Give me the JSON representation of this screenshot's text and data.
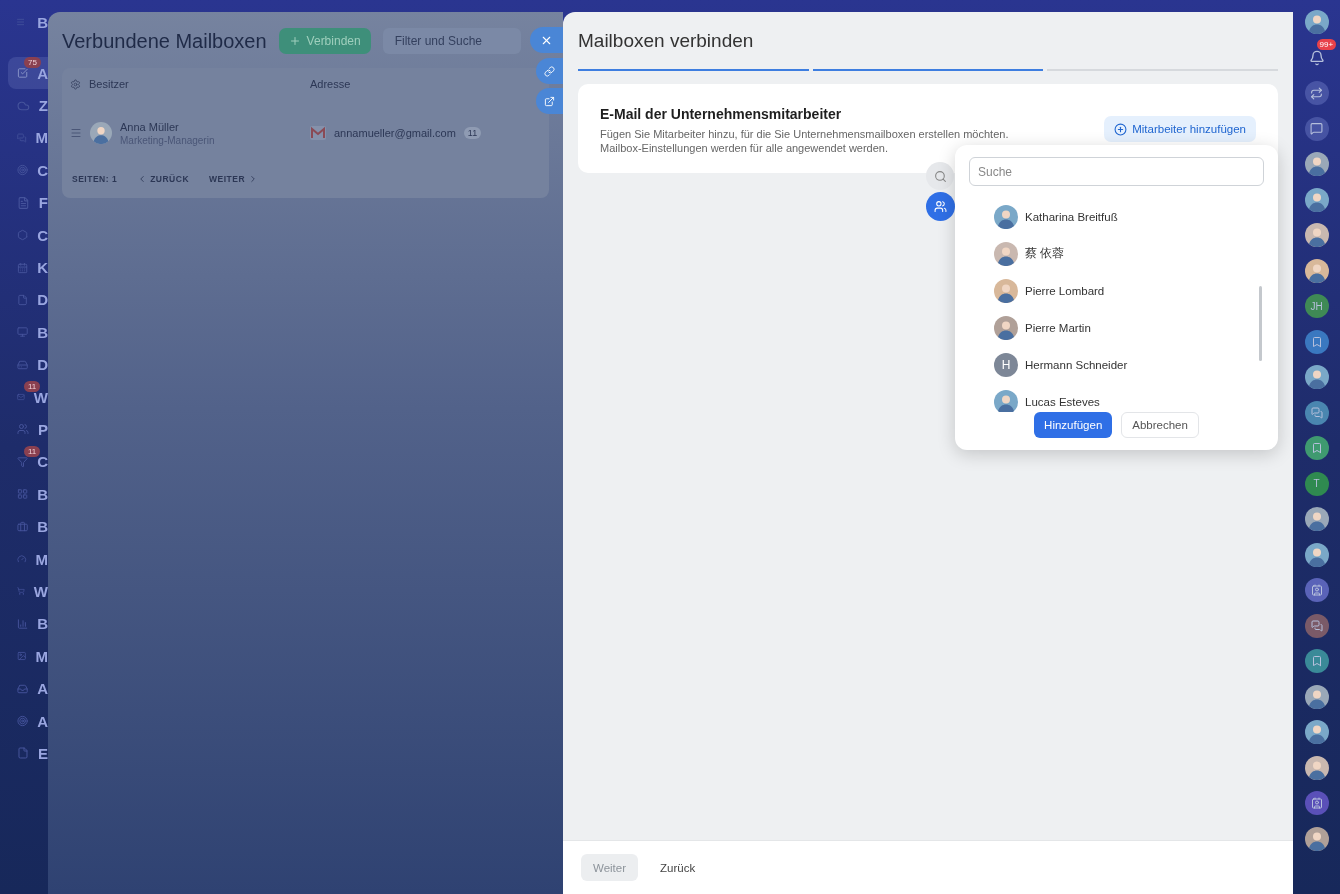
{
  "sidebar": {
    "logo": "B",
    "items": [
      {
        "label": "A",
        "badge": "75",
        "selected": true
      },
      {
        "label": "Z",
        "selected": false
      },
      {
        "label": "M",
        "selected": false
      },
      {
        "label": "C",
        "selected": false
      },
      {
        "label": "F",
        "selected": false
      },
      {
        "label": "C",
        "selected": false
      },
      {
        "label": "K",
        "selected": false
      },
      {
        "label": "D",
        "selected": false
      },
      {
        "label": "B",
        "selected": false
      },
      {
        "label": "D",
        "selected": false
      },
      {
        "label": "W",
        "badge": "11",
        "selected": false
      },
      {
        "label": "P",
        "selected": false
      },
      {
        "label": "C",
        "badge": "11",
        "selected": false
      },
      {
        "label": "B",
        "selected": false
      },
      {
        "label": "B",
        "selected": false
      },
      {
        "label": "M",
        "selected": false
      },
      {
        "label": "W",
        "selected": false
      },
      {
        "label": "B",
        "selected": false
      },
      {
        "label": "M",
        "selected": false
      },
      {
        "label": "A",
        "selected": false
      },
      {
        "label": "A",
        "selected": false
      },
      {
        "label": "E",
        "selected": false
      }
    ]
  },
  "background_page": {
    "title": "Verbundene Mailboxen",
    "connect_button": "Verbinden",
    "filter": {
      "placeholder": "Filter und Suche"
    },
    "columns": [
      "Besitzer",
      "Adresse"
    ],
    "rows": [
      {
        "name": "Anna Müller",
        "role": "Marketing-Managerin",
        "address": "annamueller@gmail.com",
        "count": "11"
      }
    ],
    "pager": {
      "label": "SEITEN:",
      "page": "1",
      "prev": "ZURÜCK",
      "next": "WEITER"
    }
  },
  "slider": {
    "title": "Mailboxen verbinden",
    "steps": [
      {
        "done": true
      },
      {
        "done": true
      },
      {
        "done": false
      }
    ],
    "section": {
      "title": "E-Mail der Unternehmensmitarbeiter",
      "description": "Fügen Sie Mitarbeiter hinzu, für die Sie Unternehmensmailboxen erstellen möchten. Mailbox-Einstellungen werden für alle angewendet werden.",
      "add_button": "Mitarbeiter hinzufügen"
    },
    "picker": {
      "search": {
        "placeholder": "Suche"
      },
      "people": [
        {
          "name": "Katharina Breitfuß",
          "kind": "photo"
        },
        {
          "name": "蔡 依蓉",
          "kind": "photo"
        },
        {
          "name": "Pierre Lombard",
          "kind": "photo"
        },
        {
          "name": "Pierre Martin",
          "kind": "photo"
        },
        {
          "name": "Hermann Schneider",
          "kind": "initials",
          "initials": "H"
        },
        {
          "name": "Lucas Esteves",
          "kind": "photo"
        }
      ],
      "confirm": "Hinzufügen",
      "cancel": "Abbrechen"
    },
    "footer": {
      "next": {
        "label": "Weiter",
        "disabled": true
      },
      "back": "Zurück"
    }
  },
  "right_rail": [
    {
      "kind": "avatar"
    },
    {
      "kind": "bell",
      "badge": "99+"
    },
    {
      "kind": "icon"
    },
    {
      "kind": "icon"
    },
    {
      "kind": "avatar"
    },
    {
      "kind": "avatar"
    },
    {
      "kind": "avatar"
    },
    {
      "kind": "avatar"
    },
    {
      "kind": "initials",
      "text": "JH",
      "color": "#3f8a55"
    },
    {
      "kind": "circle",
      "color": "#3a78c0"
    },
    {
      "kind": "avatar"
    },
    {
      "kind": "circle",
      "color": "#4a86b0"
    },
    {
      "kind": "circle",
      "color": "#3f9a70"
    },
    {
      "kind": "initials",
      "text": "T",
      "color": "#2f8a50"
    },
    {
      "kind": "avatar"
    },
    {
      "kind": "avatar"
    },
    {
      "kind": "circle",
      "color": "#5a63b8"
    },
    {
      "kind": "circle",
      "color": "#7a5a68"
    },
    {
      "kind": "circle",
      "color": "#3a8a98"
    },
    {
      "kind": "avatar"
    },
    {
      "kind": "avatar"
    },
    {
      "kind": "avatar"
    },
    {
      "kind": "circle",
      "color": "#5a50b8"
    },
    {
      "kind": "avatar"
    }
  ]
}
